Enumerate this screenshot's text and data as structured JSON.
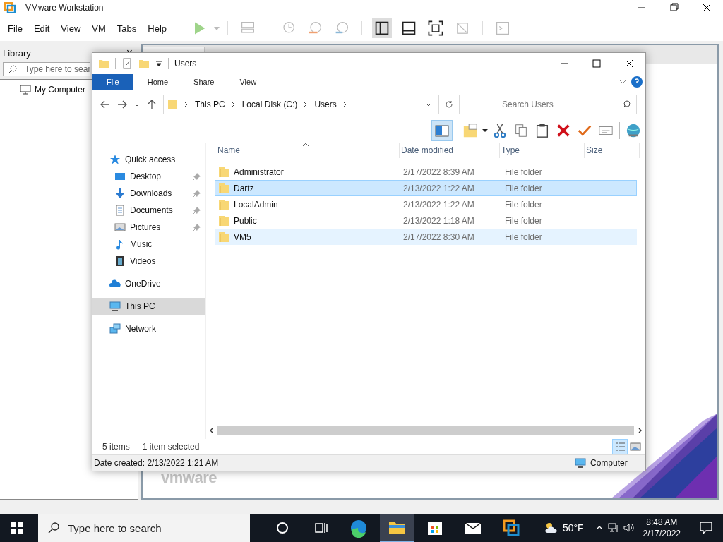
{
  "vmware": {
    "title": "VMware Workstation",
    "menu": [
      "File",
      "Edit",
      "View",
      "VM",
      "Tabs",
      "Help"
    ],
    "library": {
      "title": "Library",
      "close": "×",
      "search_placeholder": "Type here to sear",
      "tree": [
        {
          "label": "My Computer",
          "selected": false
        }
      ]
    },
    "logo": "vmware"
  },
  "explorer": {
    "title": "Users",
    "ribbon_tabs": [
      {
        "label": "File",
        "selected": true
      },
      {
        "label": "Home",
        "selected": false
      },
      {
        "label": "Share",
        "selected": false
      },
      {
        "label": "View",
        "selected": false
      }
    ],
    "breadcrumb": [
      "This PC",
      "Local Disk (C:)",
      "Users"
    ],
    "search": {
      "placeholder": "Search Users"
    },
    "columns": [
      "Name",
      "Date modified",
      "Type",
      "Size"
    ],
    "rows": [
      {
        "name": "Administrator",
        "date": "2/17/2022 8:39 AM",
        "type": "File folder",
        "selected": false,
        "hover": false
      },
      {
        "name": "Dartz",
        "date": "2/13/2022 1:22 AM",
        "type": "File folder",
        "selected": true,
        "hover": false
      },
      {
        "name": "LocalAdmin",
        "date": "2/13/2022 1:22 AM",
        "type": "File folder",
        "selected": false,
        "hover": false
      },
      {
        "name": "Public",
        "date": "2/13/2022 1:18 AM",
        "type": "File folder",
        "selected": false,
        "hover": false
      },
      {
        "name": "VM5",
        "date": "2/17/2022 8:30 AM",
        "type": "File folder",
        "selected": false,
        "hover": true
      }
    ],
    "navigation": [
      {
        "label": "Quick access",
        "kind": "star",
        "selected": false,
        "children": [
          {
            "label": "Desktop",
            "kind": "desktop",
            "pinned": true,
            "selected": false
          },
          {
            "label": "Downloads",
            "kind": "download",
            "pinned": true,
            "selected": false
          },
          {
            "label": "Documents",
            "kind": "document",
            "pinned": true,
            "selected": false
          },
          {
            "label": "Pictures",
            "kind": "picture",
            "pinned": true,
            "selected": false
          },
          {
            "label": "Music",
            "kind": "music",
            "pinned": false,
            "selected": false
          },
          {
            "label": "Videos",
            "kind": "video",
            "pinned": false,
            "selected": false
          }
        ]
      },
      {
        "label": "OneDrive",
        "kind": "cloud",
        "selected": false
      },
      {
        "label": "This PC",
        "kind": "computer",
        "selected": true
      },
      {
        "label": "Network",
        "kind": "network",
        "selected": false
      }
    ],
    "status": {
      "item_count": "5 items",
      "selection": "1 item selected"
    },
    "view_modes": [
      {
        "kind": "details",
        "selected": true
      },
      {
        "kind": "tiles",
        "selected": false
      }
    ],
    "details_bar": {
      "info": "Date created: 2/13/2022 1:21 AM",
      "location": "Computer"
    }
  },
  "taskbar": {
    "search_placeholder": "Type here to search",
    "apps": [
      {
        "kind": "edge",
        "active": false
      },
      {
        "kind": "explorer",
        "active": true
      },
      {
        "kind": "store",
        "active": false
      },
      {
        "kind": "mail",
        "active": false
      },
      {
        "kind": "vmware",
        "active": false
      }
    ],
    "weather": "50°F",
    "time": "8:48 AM",
    "date": "2/17/2022"
  }
}
